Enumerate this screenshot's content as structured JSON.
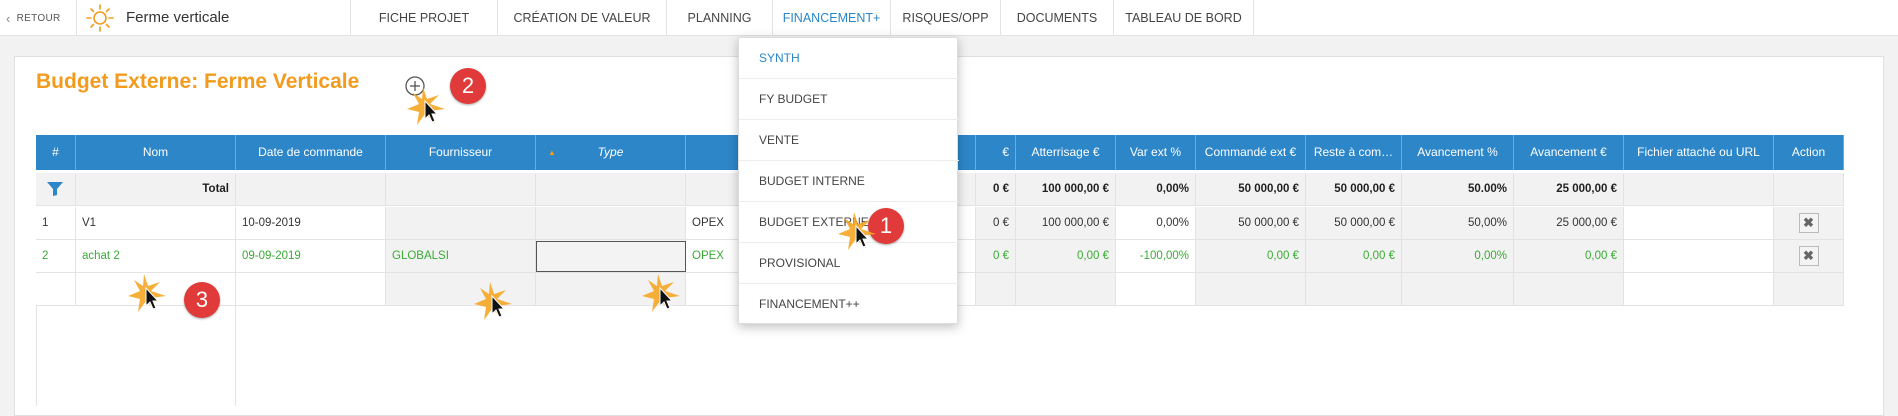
{
  "nav": {
    "back_label": "RETOUR",
    "project_title": "Ferme verticale",
    "tabs": [
      {
        "label": "FICHE PROJET"
      },
      {
        "label": "CRÉATION DE VALEUR"
      },
      {
        "label": "PLANNING"
      },
      {
        "label": "FINANCEMENT+"
      },
      {
        "label": "RISQUES/OPP"
      },
      {
        "label": "DOCUMENTS"
      },
      {
        "label": "TABLEAU DE BORD"
      }
    ],
    "active_tab": "FINANCEMENT+",
    "accent_color": "#2a87c7"
  },
  "page": {
    "title": "Budget Externe: Ferme Verticale",
    "title_color": "#f29b1d",
    "step_badges": [
      "1",
      "2",
      "3"
    ]
  },
  "dropdown": {
    "items": [
      {
        "label": "SYNTH"
      },
      {
        "label": "FY BUDGET"
      },
      {
        "label": "VENTE"
      },
      {
        "label": "BUDGET INTERNE"
      },
      {
        "label": "BUDGET EXTERNE"
      },
      {
        "label": "PROVISIONAL"
      },
      {
        "label": "FINANCEMENT++"
      }
    ],
    "active_item": "SYNTH"
  },
  "table": {
    "header_color": "#2d86c8",
    "columns": [
      "#",
      "Nom",
      "Date de commande",
      "Fournisseur",
      "Type",
      "",
      "€",
      "Atterrisage €",
      "Var ext %",
      "Commandé ext €",
      "Reste à com…",
      "Avancement %",
      "Avancement €",
      "Fichier attaché ou URL",
      "Action"
    ],
    "total_row": {
      "label": "Total",
      "budget_partial": "0 €",
      "atterrisage": "100 000,00 €",
      "var_ext": "0,00%",
      "commande_ext": "50 000,00 €",
      "reste": "50 000,00 €",
      "avancement_pct": "50.00%",
      "avancement_eur": "25 000,00 €"
    },
    "rows": [
      {
        "num": "1",
        "nom": "V1",
        "date": "10-09-2019",
        "fournisseur": "",
        "type": "",
        "category": "OPEX",
        "budget_partial": "0 €",
        "atterrisage": "100 000,00 €",
        "var_ext": "0,00%",
        "commande_ext": "50 000,00 €",
        "reste": "50 000,00 €",
        "avancement_pct": "50,00%",
        "avancement_eur": "25 000,00 €"
      },
      {
        "num": "2",
        "nom": "achat 2",
        "date": "09-09-2019",
        "fournisseur": "GLOBALSI",
        "type": "",
        "category": "OPEX",
        "budget_partial": "0 €",
        "atterrisage": "0,00 €",
        "var_ext": "-100,00%",
        "commande_ext": "0,00 €",
        "reste": "0,00 €",
        "avancement_pct": "0,00%",
        "avancement_eur": "0,00 €"
      }
    ],
    "row2_color": "#3aaa35"
  }
}
